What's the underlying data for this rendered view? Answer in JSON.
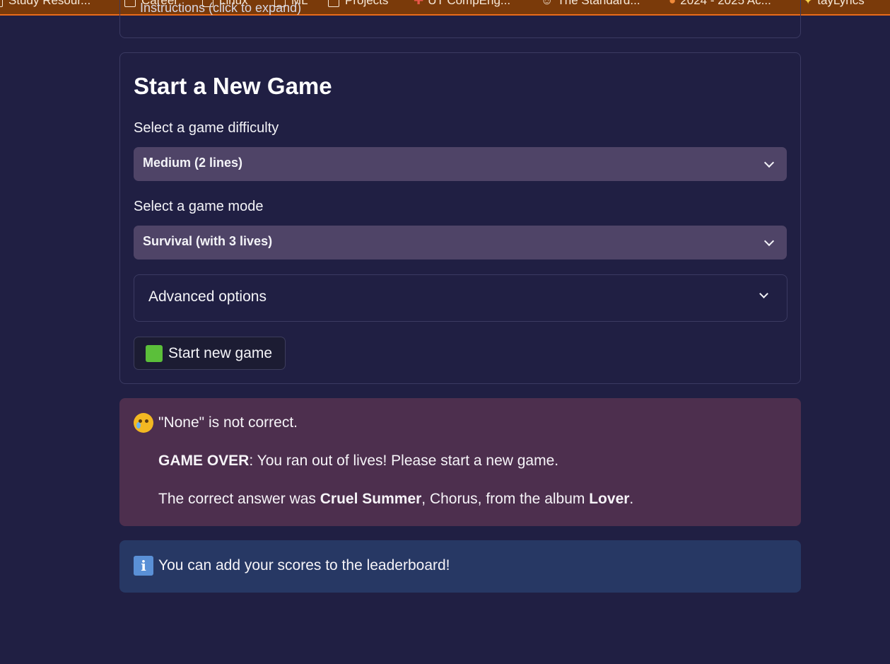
{
  "bookmarks": [
    {
      "label": "Study Resour...",
      "icon": "folder-icon"
    },
    {
      "label": "Career",
      "icon": "folder-icon"
    },
    {
      "label": "Linux",
      "icon": "folder-icon"
    },
    {
      "label": "ML",
      "icon": "folder-icon"
    },
    {
      "label": "Projects",
      "icon": "folder-icon"
    },
    {
      "label": "UT CompEng...",
      "icon": "puzzle-icon"
    },
    {
      "label": "The Standard...",
      "icon": "smile-icon"
    },
    {
      "label": "2024 - 2025 Ac...",
      "icon": "pin-icon"
    },
    {
      "label": "tayLyrics",
      "icon": "sparkle-icon"
    }
  ],
  "instructions_expander": {
    "label": "Instructions (click to expand)"
  },
  "new_game": {
    "title": "Start a New Game",
    "difficulty_label": "Select a game difficulty",
    "difficulty_value": "Medium (2 lines)",
    "mode_label": "Select a game mode",
    "mode_value": "Survival (with 3 lives)",
    "advanced_label": "Advanced options",
    "start_button": "Start new game"
  },
  "error_alert": {
    "line1": "\"None\" is not correct.",
    "game_over_bold": "GAME OVER",
    "game_over_rest": ": You ran out of lives! Please start a new game.",
    "answer_prefix": "The correct answer was ",
    "answer_song": "Cruel Summer",
    "answer_mid": ", Chorus, from the album ",
    "answer_album": "Lover",
    "answer_end": "."
  },
  "info_alert": {
    "text": "You can add your scores to the leaderboard!"
  },
  "colors": {
    "background": "#201f43",
    "error_bg": "#4d2f4e",
    "info_bg": "#273864",
    "select_bg": "#4f4467"
  }
}
